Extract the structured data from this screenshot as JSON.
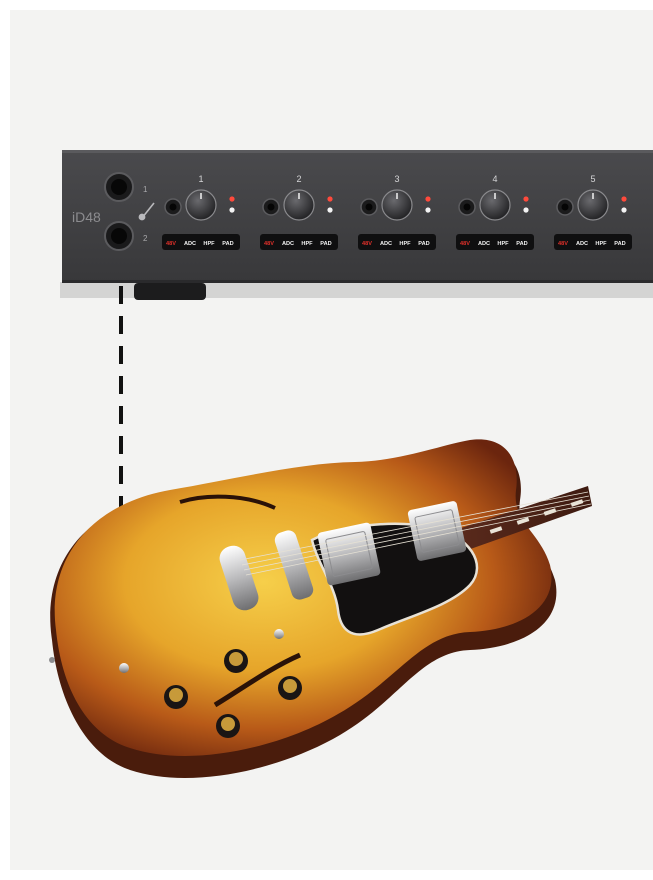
{
  "device": {
    "brand": "iD48",
    "input_numbers": [
      "1",
      "2"
    ],
    "channels": [
      {
        "number": "1"
      },
      {
        "number": "2"
      },
      {
        "number": "3"
      },
      {
        "number": "4"
      },
      {
        "number": "5"
      }
    ],
    "buttons": {
      "phantom": "48V",
      "adc": "ADC",
      "hpf": "HPF",
      "pad": "PAD"
    }
  },
  "colors": {
    "background": "#f3f3f2",
    "device_body": "#3d3d3f",
    "button_strip": "#0f0f10",
    "phantom_text": "#e0302a",
    "led_red": "#ff4a3c",
    "led_white": "#f4f4f4",
    "cable_line": "#111111",
    "guitar_sunburst_center": "#f2c03a",
    "guitar_sunburst_edge": "#7a2a10"
  },
  "icons": [
    "guitar-icon",
    "xlr-jack-icon",
    "gain-knob-icon",
    "led-icon"
  ]
}
